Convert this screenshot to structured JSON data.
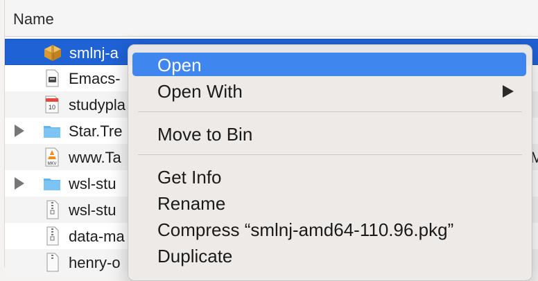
{
  "column_header": "Name",
  "files": [
    {
      "name": "smlnj-amd64-110.96.pkg",
      "shown": "smlnj-a",
      "icon": "package-icon",
      "expandable": false,
      "selected": true
    },
    {
      "name": "Emacs-",
      "shown": "Emacs-",
      "icon": "disk-image-icon",
      "expandable": false
    },
    {
      "name": "studypla",
      "shown": "studypla",
      "icon": "calendar-icon",
      "expandable": false,
      "calendar_day": "10"
    },
    {
      "name": "Star.Tre",
      "shown": "Star.Tre",
      "icon": "folder-icon",
      "expandable": true
    },
    {
      "name": "www.Ta",
      "shown": "www.Ta",
      "icon": "mkv-video-icon",
      "expandable": false,
      "badge": "MKV",
      "tail": "M"
    },
    {
      "name": "wsl-stu",
      "shown": "wsl-stu",
      "icon": "folder-icon",
      "expandable": true
    },
    {
      "name": "wsl-stu",
      "shown": "wsl-stu",
      "icon": "zip-archive-icon",
      "expandable": false
    },
    {
      "name": "data-ma",
      "shown": "data-ma",
      "icon": "zip-archive-icon",
      "expandable": false
    },
    {
      "name": "henry-o",
      "shown": "henry-o",
      "icon": "zip-archive-icon",
      "expandable": false
    }
  ],
  "context_menu": {
    "open": "Open",
    "open_with": "Open With",
    "move_to_bin": "Move to Bin",
    "get_info": "Get Info",
    "rename": "Rename",
    "compress": "Compress “smlnj-amd64-110.96.pkg”",
    "duplicate": "Duplicate"
  },
  "colors": {
    "selection": "#1f62d6",
    "menu_highlight": "#3f86ee",
    "folder": "#5fb4ec"
  }
}
